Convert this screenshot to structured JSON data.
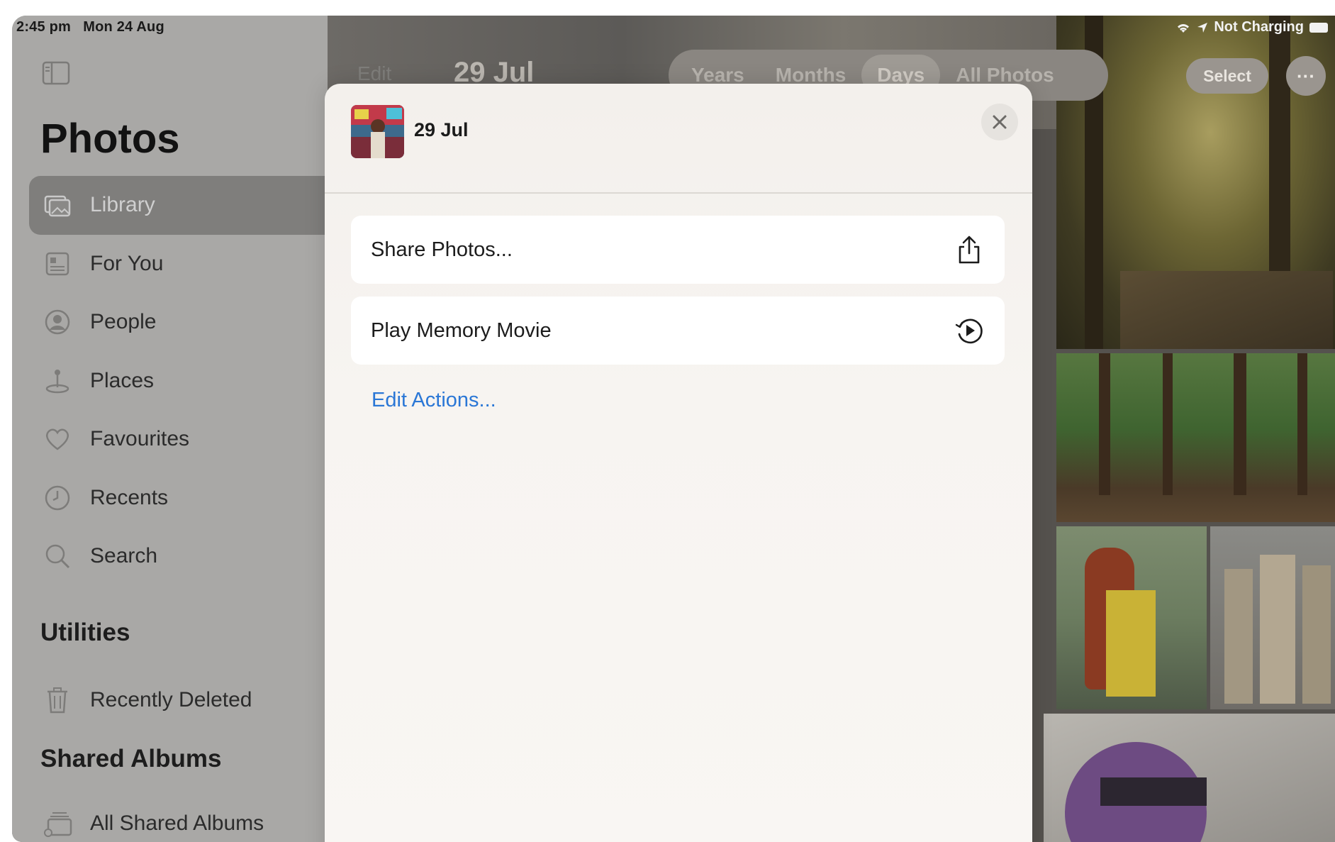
{
  "status_bar": {
    "time": "2:45 pm",
    "date": "Mon 24 Aug",
    "wifi_icon": "wifi-icon",
    "location_icon": "location-arrow-icon",
    "battery_text": "Not Charging",
    "battery_icon": "battery-icon"
  },
  "sidebar": {
    "toggle_icon": "sidebar-toggle-icon",
    "edit_label": "Edit",
    "heading": "Photos",
    "items": [
      {
        "label": "Library",
        "icon": "library-icon",
        "selected": true
      },
      {
        "label": "For You",
        "icon": "for-you-icon",
        "selected": false
      },
      {
        "label": "People",
        "icon": "people-icon",
        "selected": false
      },
      {
        "label": "Places",
        "icon": "places-icon",
        "selected": false
      },
      {
        "label": "Favourites",
        "icon": "heart-icon",
        "selected": false
      },
      {
        "label": "Recents",
        "icon": "clock-icon",
        "selected": false
      },
      {
        "label": "Search",
        "icon": "search-icon",
        "selected": false
      }
    ],
    "utilities_heading": "Utilities",
    "utilities_items": [
      {
        "label": "Recently Deleted",
        "icon": "trash-icon"
      }
    ],
    "shared_heading": "Shared Albums",
    "shared_items": [
      {
        "label": "All Shared Albums",
        "icon": "shared-albums-icon"
      }
    ]
  },
  "library": {
    "title": "29 Jul",
    "segments": [
      "Years",
      "Months",
      "Days",
      "All Photos"
    ],
    "active_segment": "Days",
    "select_label": "Select",
    "more_label": "···"
  },
  "share_sheet": {
    "title": "29 Jul",
    "close_icon": "close-icon",
    "actions": [
      {
        "label": "Share Photos...",
        "icon": "share-icon"
      },
      {
        "label": "Play Memory Movie",
        "icon": "memory-movie-icon"
      }
    ],
    "edit_actions_label": "Edit Actions...",
    "colors": {
      "link": "#2b77d6",
      "background": "#f5f2ee"
    }
  }
}
